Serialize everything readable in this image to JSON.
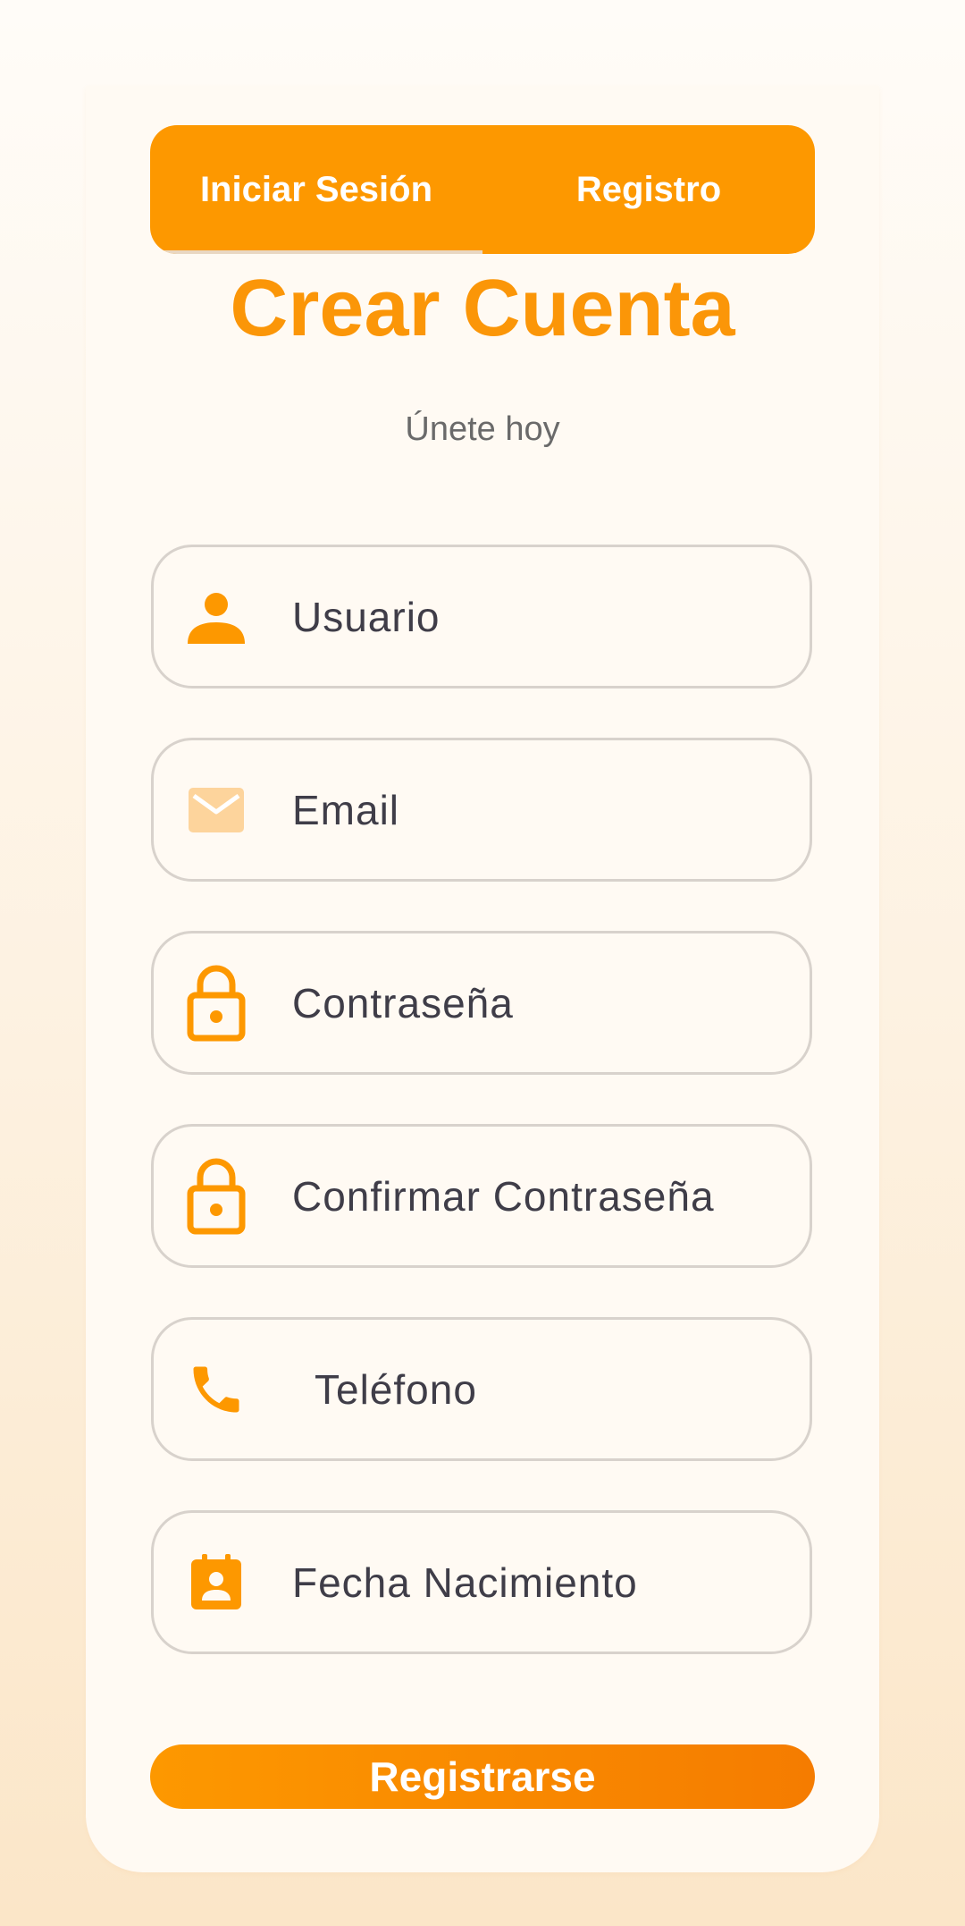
{
  "tabs": [
    {
      "label": "Iniciar Sesión",
      "active": false
    },
    {
      "label": "Registro",
      "active": true
    }
  ],
  "header": {
    "title": "Crear Cuenta",
    "subtitle": "Únete hoy"
  },
  "fields": [
    {
      "icon": "person-icon",
      "placeholder": "Usuario"
    },
    {
      "icon": "email-icon",
      "placeholder": "Email"
    },
    {
      "icon": "lock-icon",
      "placeholder": "Contraseña"
    },
    {
      "icon": "lock-icon",
      "placeholder": "Confirmar Contraseña"
    },
    {
      "icon": "phone-icon",
      "placeholder": "Teléfono"
    },
    {
      "icon": "calendar-person-icon",
      "placeholder": "Fecha Nacimiento"
    }
  ],
  "submit": {
    "label": "Registrarse"
  },
  "colors": {
    "accent": "#fd9800",
    "accent_dark": "#f57c00",
    "email_icon": "#fdd49c",
    "field_text": "#3f3d48",
    "field_border": "#d8d2cc"
  }
}
